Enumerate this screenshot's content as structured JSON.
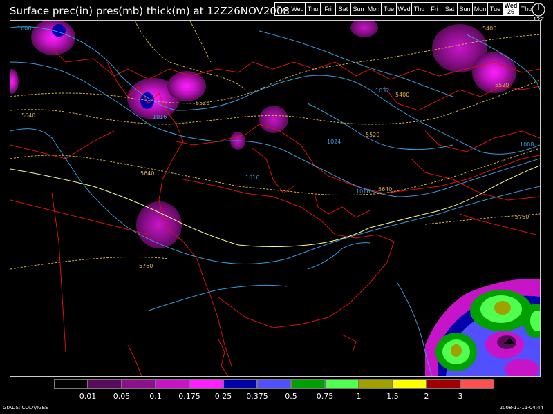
{
  "title": "Surface prec(in) pres(mb) thick(m) at 12Z26NOV2008",
  "day_strip": [
    {
      "label": "Tue"
    },
    {
      "label": "Wed"
    },
    {
      "label": "Thu"
    },
    {
      "label": "Fri"
    },
    {
      "label": "Sat"
    },
    {
      "label": "Sun"
    },
    {
      "label": "Mon"
    },
    {
      "label": "Tue"
    },
    {
      "label": "Wed"
    },
    {
      "label": "Thu"
    },
    {
      "label": "Fri"
    },
    {
      "label": "Sat"
    },
    {
      "label": "Sun"
    },
    {
      "label": "Mon"
    },
    {
      "label": "Tue"
    },
    {
      "label": "Wed",
      "sub": "26",
      "selected": true
    },
    {
      "label": "Thu"
    }
  ],
  "clock_label": "12Z",
  "pressure_labels": [
    {
      "text": "1008"
    },
    {
      "text": "1016"
    },
    {
      "text": "1032"
    },
    {
      "text": "1024"
    },
    {
      "text": "1016"
    },
    {
      "text": "1016"
    },
    {
      "text": "1008"
    }
  ],
  "thickness_labels": [
    {
      "text": "5400"
    },
    {
      "text": "5520"
    },
    {
      "text": "5640"
    },
    {
      "text": "5520"
    },
    {
      "text": "5400"
    },
    {
      "text": "5520"
    },
    {
      "text": "5640"
    },
    {
      "text": "5640"
    },
    {
      "text": "5760"
    },
    {
      "text": "5760"
    }
  ],
  "legend": {
    "colors": [
      "#000000",
      "#5a0a5a",
      "#8c0f8c",
      "#c814c8",
      "#ff1eff",
      "#0000aa",
      "#5050ff",
      "#00a000",
      "#50ff50",
      "#a0a000",
      "#ffff00",
      "#a00000",
      "#ff5050"
    ],
    "labels": [
      "0.01",
      "0.05",
      "0.1",
      "0.175",
      "0.25",
      "0.375",
      "0.5",
      "0.75",
      "1",
      "1.5",
      "2",
      "3"
    ]
  },
  "footer_left": "GrADS: COLA/IGES",
  "footer_right": "2008-11-11-04:44",
  "colors": {
    "pressure": "#3a9adc",
    "thickness": "#d8b04a",
    "thickness_warm": "#ffff80",
    "borders": "#e01010",
    "frame": "#cccccc"
  }
}
